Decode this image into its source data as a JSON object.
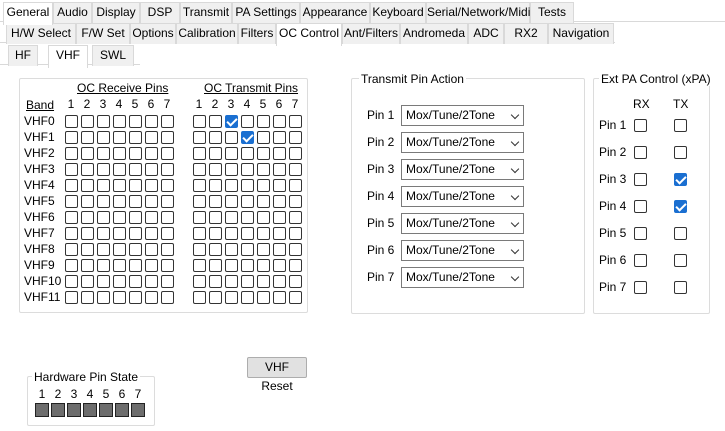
{
  "tabs_main": [
    "General",
    "Audio",
    "Display",
    "DSP",
    "Transmit",
    "PA Settings",
    "Appearance",
    "Keyboard",
    "Serial/Network/Midi CAT",
    "Tests"
  ],
  "tabs_sub": [
    "H/W Select",
    "F/W Set",
    "Options",
    "Calibration",
    "Filters",
    "OC Control",
    "Ant/Filters",
    "Andromeda",
    "ADC",
    "RX2",
    "Navigation"
  ],
  "tabs_band": [
    "HF",
    "VHF",
    "SWL"
  ],
  "oc": {
    "receive_label": "OC Receive Pins",
    "transmit_label": "OC Transmit Pins",
    "band_header": "Band",
    "pin_numbers": [
      "1",
      "2",
      "3",
      "4",
      "5",
      "6",
      "7"
    ],
    "bands": [
      "VHF0",
      "VHF1",
      "VHF2",
      "VHF3",
      "VHF4",
      "VHF5",
      "VHF6",
      "VHF7",
      "VHF8",
      "VHF9",
      "VHF10",
      "VHF11"
    ],
    "receive_checked": [],
    "transmit_checked": [
      [
        0,
        2
      ],
      [
        1,
        3
      ]
    ]
  },
  "tx_action": {
    "title": "Transmit Pin Action",
    "pins": [
      {
        "label": "Pin 1",
        "value": "Mox/Tune/2Tone"
      },
      {
        "label": "Pin 2",
        "value": "Mox/Tune/2Tone"
      },
      {
        "label": "Pin 3",
        "value": "Mox/Tune/2Tone"
      },
      {
        "label": "Pin 4",
        "value": "Mox/Tune/2Tone"
      },
      {
        "label": "Pin 5",
        "value": "Mox/Tune/2Tone"
      },
      {
        "label": "Pin 6",
        "value": "Mox/Tune/2Tone"
      },
      {
        "label": "Pin 7",
        "value": "Mox/Tune/2Tone"
      }
    ]
  },
  "ext_pa": {
    "title": "Ext PA Control (xPA)",
    "rx_label": "RX",
    "tx_label": "TX",
    "pins": [
      {
        "label": "Pin 1",
        "rx": false,
        "tx": false
      },
      {
        "label": "Pin 2",
        "rx": false,
        "tx": false
      },
      {
        "label": "Pin 3",
        "rx": false,
        "tx": true
      },
      {
        "label": "Pin 4",
        "rx": false,
        "tx": true
      },
      {
        "label": "Pin 5",
        "rx": false,
        "tx": false
      },
      {
        "label": "Pin 6",
        "rx": false,
        "tx": false
      },
      {
        "label": "Pin 7",
        "rx": false,
        "tx": false
      }
    ]
  },
  "reset_button": "VHF Reset",
  "hw_state": {
    "title": "Hardware Pin State",
    "pins": [
      "1",
      "2",
      "3",
      "4",
      "5",
      "6",
      "7"
    ]
  },
  "colors": {
    "accent": "#1a6fd1",
    "led": "#6d6d6d"
  }
}
